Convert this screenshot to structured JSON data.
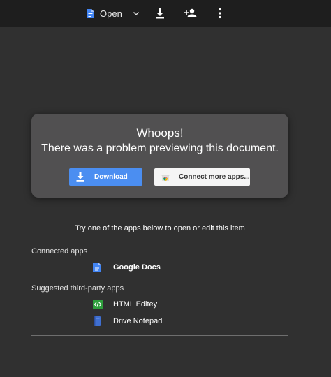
{
  "topbar": {
    "open_label": "Open",
    "icons": [
      "docs-icon",
      "chevron-down-icon",
      "download-icon",
      "add-person-icon",
      "more-vert-icon"
    ]
  },
  "dialog": {
    "title": "Whoops!",
    "subtitle": "There was a problem previewing this document.",
    "download_label": "Download",
    "connect_label": "Connect more apps..."
  },
  "apps": {
    "prompt": "Try one of the apps below to open or edit this item",
    "connected_heading": "Connected apps",
    "connected": [
      {
        "name": "Google Docs",
        "icon": "google-docs-icon"
      }
    ],
    "suggested_heading": "Suggested third-party apps",
    "suggested": [
      {
        "name": "HTML Editey",
        "icon": "html-editey-icon"
      },
      {
        "name": "Drive Notepad",
        "icon": "drive-notepad-icon"
      }
    ]
  },
  "colors": {
    "background": "#303030",
    "topbar": "#1e1e1e",
    "dialog": "#515051",
    "primary": "#4b8ef1",
    "docs_blue": "#4285f4",
    "editey_green": "#2e9e3c"
  }
}
